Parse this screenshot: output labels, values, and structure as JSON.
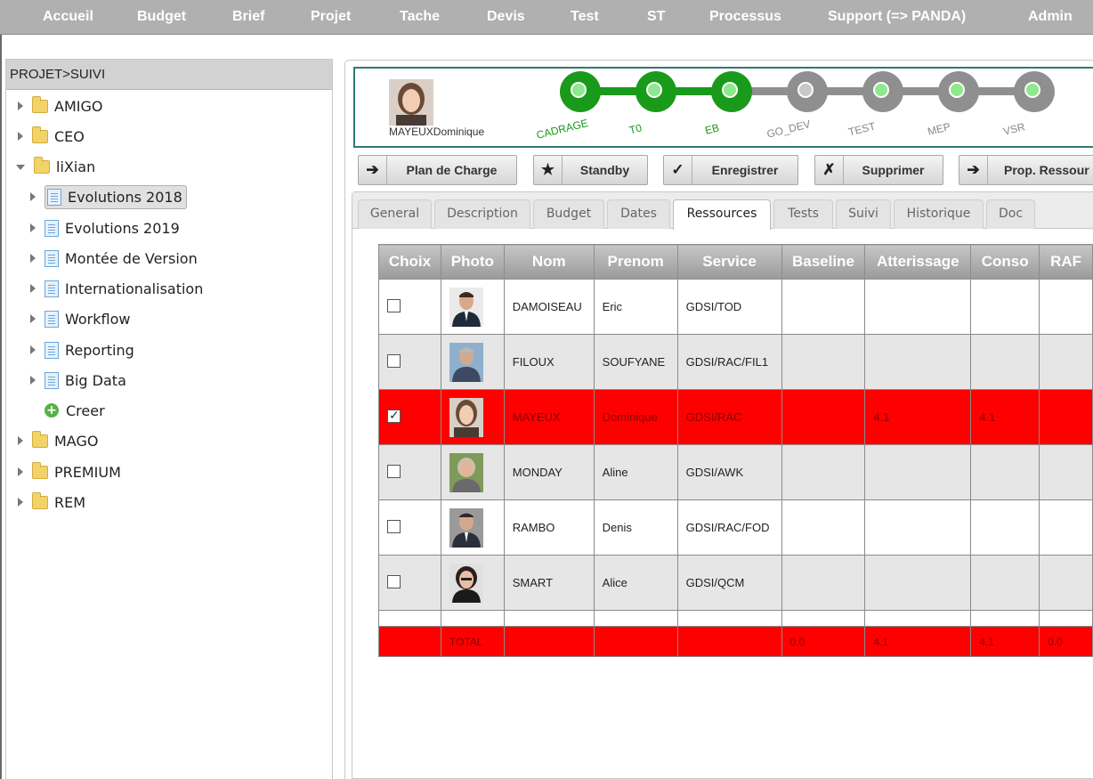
{
  "nav": [
    "Accueil",
    "Budget",
    "Brief",
    "Projet",
    "Tache",
    "Devis",
    "Test",
    "ST",
    "Processus",
    "Support (=> PANDA)",
    "Admin"
  ],
  "tree": {
    "header": "PROJET>SUIVI",
    "items": [
      {
        "label": "AMIGO"
      },
      {
        "label": "CEO"
      },
      {
        "label": "liXian"
      },
      {
        "label": "Evolutions 2018"
      },
      {
        "label": "Evolutions 2019"
      },
      {
        "label": "Montée de Version"
      },
      {
        "label": "Internationalisation"
      },
      {
        "label": "Workflow"
      },
      {
        "label": "Reporting"
      },
      {
        "label": "Big Data"
      },
      {
        "label": "Creer"
      },
      {
        "label": "MAGO"
      },
      {
        "label": "PREMIUM"
      },
      {
        "label": "REM"
      }
    ]
  },
  "owner": {
    "name": "MAYEUXDominique"
  },
  "workflow": {
    "steps": [
      {
        "label": "CADRAGE",
        "status": "done"
      },
      {
        "label": "T0",
        "status": "done"
      },
      {
        "label": "EB",
        "status": "done"
      },
      {
        "label": "GO_DEV",
        "status": "current"
      },
      {
        "label": "TEST",
        "status": "pending"
      },
      {
        "label": "MEP",
        "status": "pending"
      },
      {
        "label": "VSR",
        "status": "pending"
      }
    ],
    "colors": {
      "done": "#1a9a1a",
      "pending": "#8f8f8f",
      "dot_green": "#8ee88e",
      "dot_grey": "#c8c8c8"
    }
  },
  "actions": [
    {
      "label": "Plan de Charge",
      "icon": "arrow-right-icon"
    },
    {
      "label": "Standby",
      "icon": "star-icon"
    },
    {
      "label": "Enregistrer",
      "icon": "check-icon"
    },
    {
      "label": "Supprimer",
      "icon": "cross-icon"
    },
    {
      "label": "Prop. Ressour",
      "icon": "arrow-right-icon"
    }
  ],
  "tabs": [
    {
      "label": "General"
    },
    {
      "label": "Description"
    },
    {
      "label": "Budget"
    },
    {
      "label": "Dates"
    },
    {
      "label": "Ressources",
      "active": true
    },
    {
      "label": "Tests"
    },
    {
      "label": "Suivi"
    },
    {
      "label": "Historique"
    },
    {
      "label": "Doc"
    }
  ],
  "table": {
    "columns": [
      "Choix",
      "Photo",
      "Nom",
      "Prenom",
      "Service",
      "Baseline",
      "Atterissage",
      "Conso",
      "RAF"
    ],
    "rows": [
      {
        "nom": "DAMOISEAU",
        "prenom": "Eric",
        "service": "GDSI/TOD",
        "baseline": "",
        "atterissage": "",
        "conso": "",
        "raf": "",
        "checked": false
      },
      {
        "nom": "FILOUX",
        "prenom": "SOUFYANE",
        "service": "GDSI/RAC/FIL1",
        "baseline": "",
        "atterissage": "",
        "conso": "",
        "raf": "",
        "checked": false
      },
      {
        "nom": "MAYEUX",
        "prenom": "Dominique",
        "service": "GDSI/RAC",
        "baseline": "",
        "atterissage": "4.1",
        "conso": "4.1",
        "raf": "",
        "checked": true
      },
      {
        "nom": "MONDAY",
        "prenom": "Aline",
        "service": "GDSI/AWK",
        "baseline": "",
        "atterissage": "",
        "conso": "",
        "raf": "",
        "checked": false
      },
      {
        "nom": "RAMBO",
        "prenom": "Denis",
        "service": "GDSI/RAC/FOD",
        "baseline": "",
        "atterissage": "",
        "conso": "",
        "raf": "",
        "checked": false
      },
      {
        "nom": "SMART",
        "prenom": "Alice",
        "service": "GDSI/QCM",
        "baseline": "",
        "atterissage": "",
        "conso": "",
        "raf": "",
        "checked": false
      }
    ],
    "total": {
      "label": "TOTAL",
      "baseline": "0.0",
      "atterissage": "4.1",
      "conso": "4.1",
      "raf": "0.0"
    }
  },
  "colors": {
    "selected_row": "#ff0000",
    "header_bar": "#b0b0b0",
    "workflow_border": "#2e7a72"
  }
}
